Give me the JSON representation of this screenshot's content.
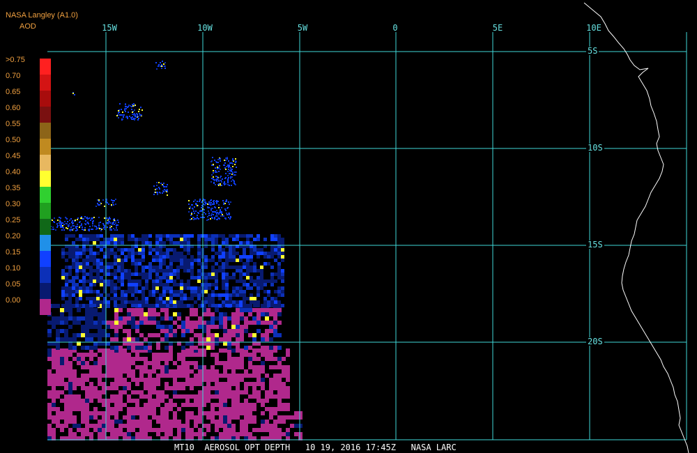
{
  "header": {
    "source": "NASA Langley (A1.0)",
    "product": "AOD"
  },
  "colors": {
    "grid": "#3fd9d9",
    "coastline": "#ffffff",
    "label": "#f0a040",
    "background": "#000000"
  },
  "map": {
    "projection": "lat-lon grid",
    "lon_range_deg": [
      -18,
      15
    ],
    "lat_range_deg": [
      -25,
      -3
    ],
    "lon_labels": [
      "15W",
      "10W",
      "5W",
      "0",
      "5E",
      "10E"
    ],
    "lat_labels": [
      "5S",
      "10S",
      "15S",
      "20S"
    ]
  },
  "legend": {
    "title": "AOD",
    "entries": [
      {
        "label": ">0.75",
        "color": "#ff2020"
      },
      {
        "label": "0.70",
        "color": "#d41414"
      },
      {
        "label": "0.65",
        "color": "#a80c0c"
      },
      {
        "label": "0.60",
        "color": "#7a1010"
      },
      {
        "label": "0.55",
        "color": "#8c6418"
      },
      {
        "label": "0.50",
        "color": "#c08a20"
      },
      {
        "label": "0.45",
        "color": "#e8b860"
      },
      {
        "label": "0.40",
        "color": "#ffff30"
      },
      {
        "label": "0.35",
        "color": "#30d030"
      },
      {
        "label": "0.30",
        "color": "#20a020"
      },
      {
        "label": "0.25",
        "color": "#106818"
      },
      {
        "label": "0.20",
        "color": "#2090e8"
      },
      {
        "label": "0.15",
        "color": "#1040ff"
      },
      {
        "label": "0.10",
        "color": "#0c30b8"
      },
      {
        "label": "0.05",
        "color": "#081a70"
      },
      {
        "label": "0.00",
        "color": "#b0288c"
      }
    ]
  },
  "footer": {
    "satellite": "MT10",
    "product_name": "AEROSOL OPT DEPTH",
    "date": "10 19, 2016",
    "time": "17:45Z",
    "producer": "NASA LARC"
  }
}
